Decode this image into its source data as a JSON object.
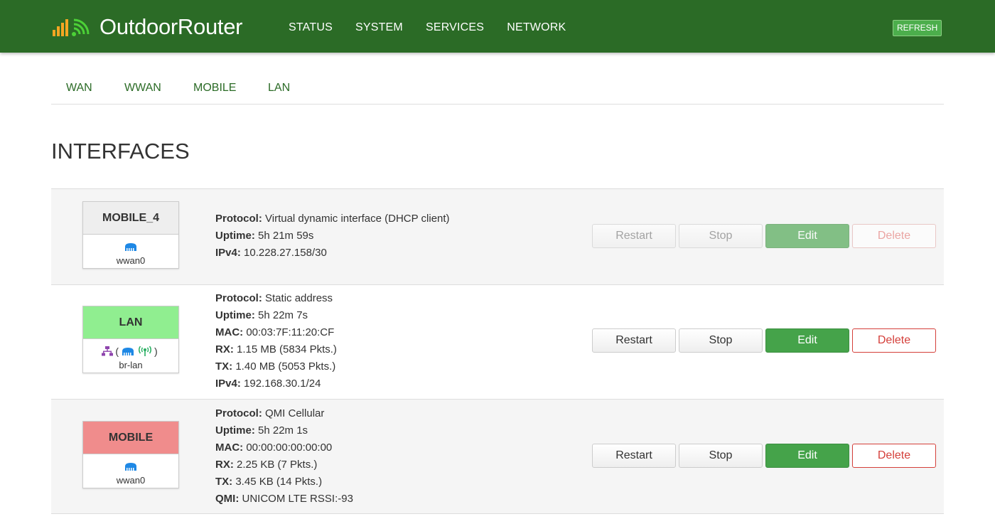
{
  "header": {
    "brand": "OutdoorRouter",
    "logo_icon": "signal-wifi-logo-icon",
    "nav": [
      "STATUS",
      "SYSTEM",
      "SERVICES",
      "NETWORK"
    ],
    "refresh_label": "REFRESH"
  },
  "subnav": [
    "WAN",
    "WWAN",
    "MOBILE",
    "LAN"
  ],
  "page_title": "INTERFACES",
  "colors": {
    "header_bg": "#2b6b26",
    "lan_badge": "#90ee90",
    "mobile_badge": "#f08c8c",
    "edit": "#45a34a",
    "delete": "#d43f3a"
  },
  "interfaces": [
    {
      "name": "MOBILE_4",
      "device": "wwan0",
      "icons": [
        "ethernet-icon"
      ],
      "info": [
        {
          "label": "Protocol:",
          "value": " Virtual dynamic interface (DHCP client)"
        },
        {
          "label": "Uptime:",
          "value": " 5h 21m 59s"
        },
        {
          "label": "IPv4:",
          "value": " 10.228.27.158/30"
        }
      ],
      "actions": {
        "restart": "Restart",
        "stop": "Stop",
        "edit": "Edit",
        "delete": "Delete"
      },
      "disabled": true
    },
    {
      "name": "LAN",
      "device": "br-lan",
      "icons": [
        "switch-icon",
        "ethernet-icon",
        "wifi-icon"
      ],
      "info": [
        {
          "label": "Protocol:",
          "value": " Static address"
        },
        {
          "label": "Uptime:",
          "value": " 5h 22m 7s"
        },
        {
          "label": "MAC:",
          "value": " 00:03:7F:11:20:CF"
        },
        {
          "label": "RX:",
          "value": " 1.15 MB (5834 Pkts.)"
        },
        {
          "label": "TX:",
          "value": " 1.40 MB (5053 Pkts.)"
        },
        {
          "label": "IPv4:",
          "value": " 192.168.30.1/24"
        }
      ],
      "actions": {
        "restart": "Restart",
        "stop": "Stop",
        "edit": "Edit",
        "delete": "Delete"
      },
      "disabled": false
    },
    {
      "name": "MOBILE",
      "device": "wwan0",
      "icons": [
        "ethernet-icon"
      ],
      "info": [
        {
          "label": "Protocol:",
          "value": " QMI Cellular"
        },
        {
          "label": "Uptime:",
          "value": " 5h 22m 1s"
        },
        {
          "label": "MAC:",
          "value": " 00:00:00:00:00:00"
        },
        {
          "label": "RX:",
          "value": " 2.25 KB (7 Pkts.)"
        },
        {
          "label": "TX:",
          "value": " 3.45 KB (14 Pkts.)"
        },
        {
          "label": "QMI:",
          "value": " UNICOM LTE RSSI:-93"
        }
      ],
      "actions": {
        "restart": "Restart",
        "stop": "Stop",
        "edit": "Edit",
        "delete": "Delete"
      },
      "disabled": false
    }
  ]
}
